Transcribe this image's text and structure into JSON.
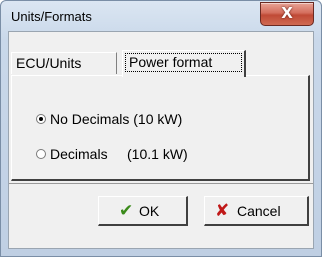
{
  "window": {
    "title": "Units/Formats",
    "close_glyph": "X"
  },
  "tabs": [
    {
      "label": "ECU/Units",
      "active": false
    },
    {
      "label": "Power format",
      "active": true
    }
  ],
  "power_format": {
    "options": [
      {
        "label": "No Decimals (10 kW)",
        "selected": true
      },
      {
        "label": "Decimals     (10.1 kW)",
        "selected": false
      }
    ]
  },
  "buttons": {
    "ok": {
      "label": "OK",
      "icon": "checkmark-icon"
    },
    "cancel": {
      "label": "Cancel",
      "icon": "x-icon"
    }
  }
}
